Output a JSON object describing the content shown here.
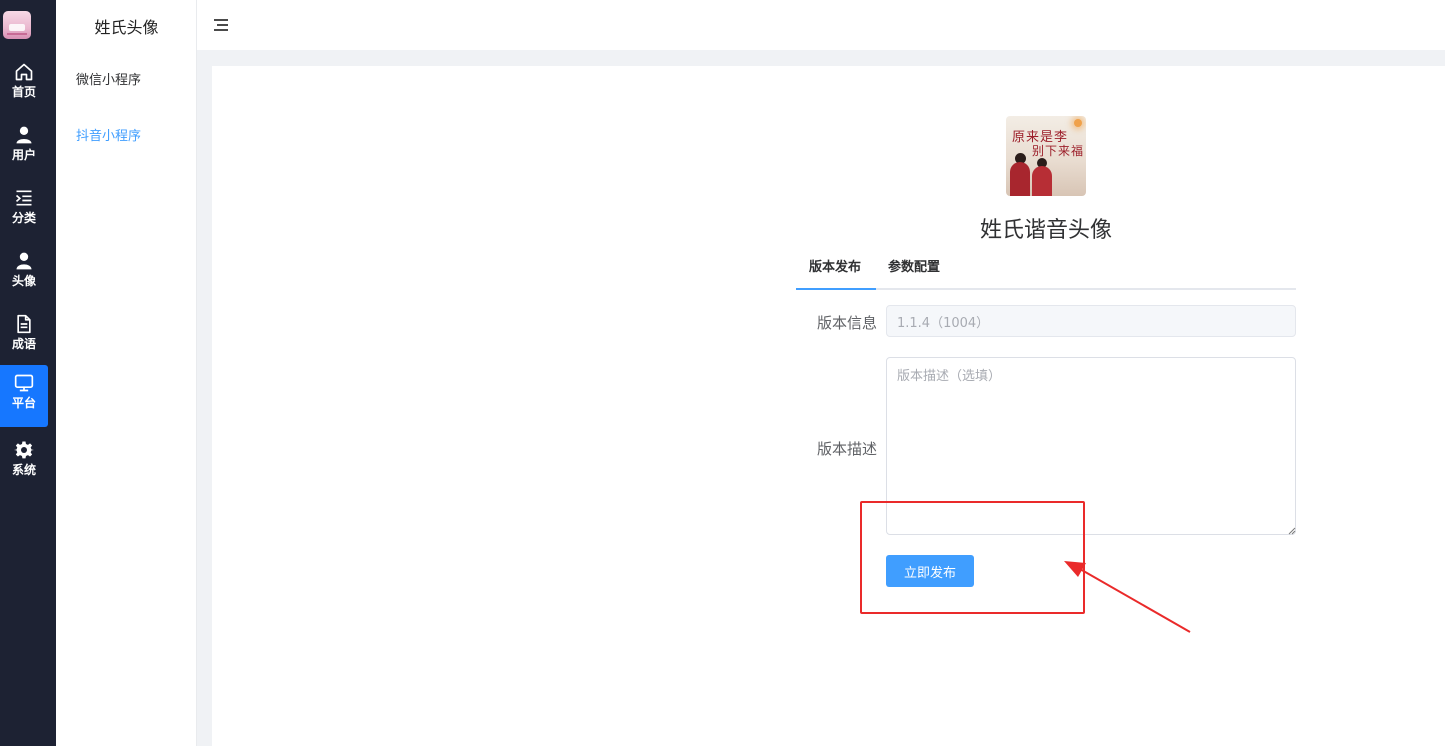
{
  "rail": {
    "items": [
      {
        "label": "首页",
        "icon": "home-icon"
      },
      {
        "label": "用户",
        "icon": "user-icon"
      },
      {
        "label": "分类",
        "icon": "list-indent-icon"
      },
      {
        "label": "头像",
        "icon": "avatar-icon"
      },
      {
        "label": "成语",
        "icon": "document-icon"
      },
      {
        "label": "平台",
        "icon": "monitor-icon",
        "active": true
      },
      {
        "label": "系统",
        "icon": "gear-icon"
      }
    ],
    "active_color": "#1677ff",
    "background": "#1d2233"
  },
  "submenu": {
    "title": "姓氏头像",
    "items": [
      {
        "label": "微信小程序"
      },
      {
        "label": "抖音小程序",
        "active": true
      }
    ],
    "active_color": "#409eff"
  },
  "app": {
    "image_text_line1": "原来是李",
    "image_text_line2": "别下来福",
    "name": "姓氏谐音头像"
  },
  "tabs": [
    {
      "label": "版本发布",
      "active": true
    },
    {
      "label": "参数配置"
    }
  ],
  "form": {
    "version_info_label": "版本信息",
    "version_info_value": "1.1.4（1004）",
    "version_desc_label": "版本描述",
    "version_desc_placeholder": "版本描述（选填）",
    "publish_label": "立即发布"
  },
  "colors": {
    "primary": "#409eff",
    "annotation": "#ea2a2a"
  }
}
